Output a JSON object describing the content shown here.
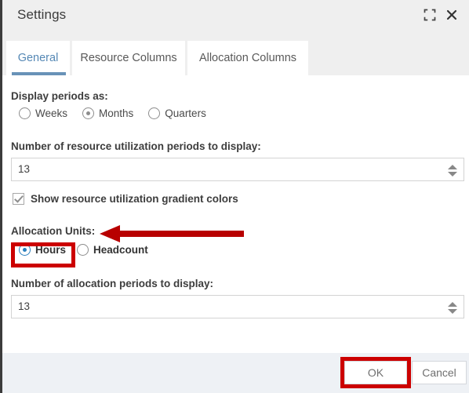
{
  "window": {
    "title": "Settings",
    "maximize_icon": "expand-icon",
    "close_icon": "close-icon"
  },
  "tabs": [
    {
      "label": "General",
      "active": true
    },
    {
      "label": "Resource Columns",
      "active": false
    },
    {
      "label": "Allocation Columns",
      "active": false
    }
  ],
  "general": {
    "display_periods_label": "Display periods as:",
    "period_options": [
      {
        "label": "Weeks",
        "selected": false
      },
      {
        "label": "Months",
        "selected": true
      },
      {
        "label": "Quarters",
        "selected": false
      }
    ],
    "resource_periods_label": "Number of resource utilization periods to display:",
    "resource_periods_value": "13",
    "gradient_checkbox_label": "Show resource utilization gradient colors",
    "gradient_checkbox_checked": true,
    "allocation_units_label": "Allocation Units:",
    "allocation_unit_options": [
      {
        "label": "Hours",
        "selected": true
      },
      {
        "label": "Headcount",
        "selected": false
      }
    ],
    "allocation_periods_label": "Number of allocation periods to display:",
    "allocation_periods_value": "13"
  },
  "footer": {
    "ok_label": "OK",
    "cancel_label": "Cancel"
  },
  "annotations": {
    "color": "#cc0000",
    "arrow_target": "Allocation Units:",
    "highlighted_items": [
      "Hours",
      "OK"
    ]
  },
  "colors": {
    "accent_blue": "#6892b8",
    "radio_blue": "#2a7fbd",
    "header_bg": "#efefef",
    "footer_bg": "#eef1f5",
    "annotation_red": "#cc0000"
  }
}
